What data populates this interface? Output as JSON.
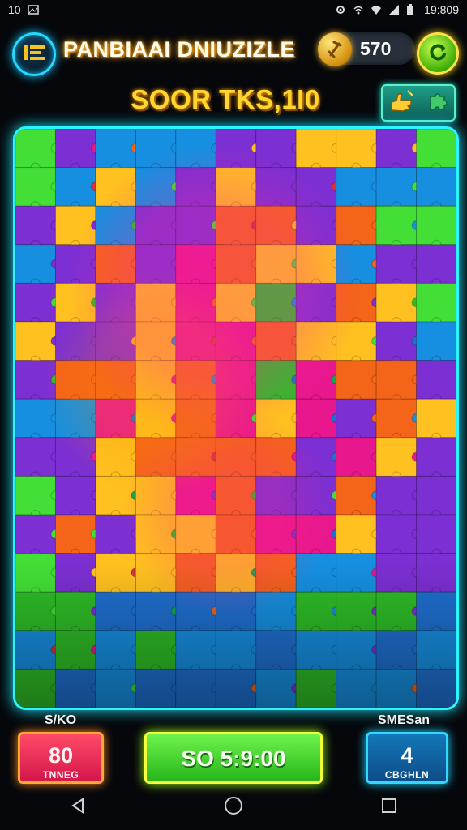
{
  "status_bar": {
    "left_text": "10",
    "time": "19:809"
  },
  "header": {
    "title": "PANBIAAI DNIUZIZLE",
    "coin_value": "570"
  },
  "score_banner": "SOOR TKS,1I0",
  "stats": {
    "left_label": "S/KO",
    "left_value": "80",
    "left_sub": "TNNEG",
    "center_value": "SO 5:9:00",
    "right_label": "SMESan",
    "right_value": "4",
    "right_sub": "CBGHLN"
  },
  "colors": {
    "accent_cyan": "#2bf3ff",
    "score_gold": "#ffd62d",
    "green": "#32c51f",
    "pink": "#e70f88",
    "orange": "#f35a15",
    "blue": "#1e64c8"
  },
  "icons": {
    "menu": "menu-icon",
    "coin": "coin-icon",
    "refresh": "refresh-icon",
    "hint_hand": "hand-pointer-icon",
    "hint_piece": "puzzle-piece-icon",
    "back": "back-icon",
    "home": "home-icon",
    "recents": "recents-icon"
  }
}
